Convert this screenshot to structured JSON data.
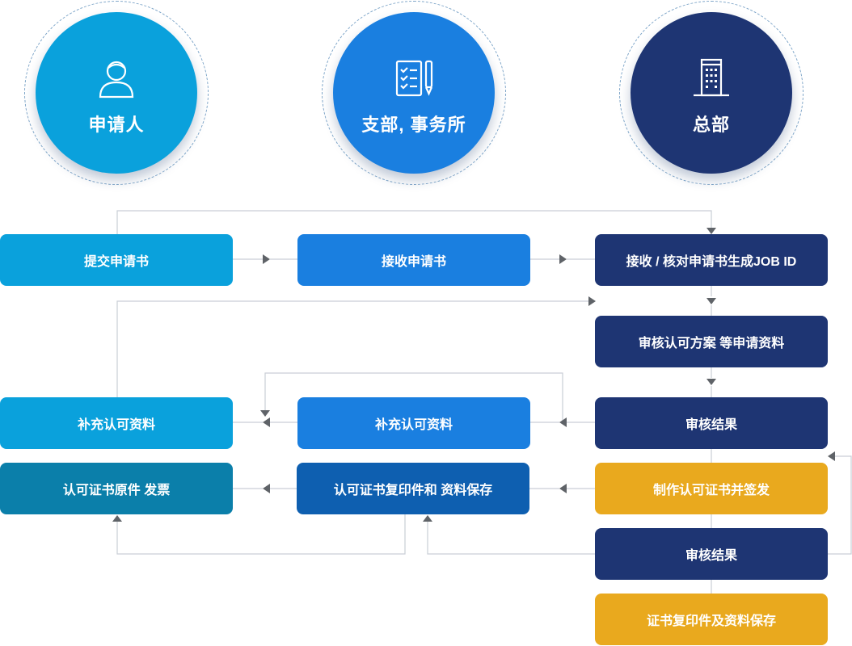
{
  "roles": {
    "applicant": "申请人",
    "branch": "支部, 事务所",
    "headquarters": "总部"
  },
  "steps": {
    "submit_application": "提交申请书",
    "receive_application": "接收申请书",
    "receive_verify": "接收 / 核对申请书生成JOB ID",
    "review_plan": "审核认可方案 等申请资料",
    "supplement_applicant": "补充认可资料",
    "supplement_branch": "补充认可资料",
    "review_result_1": "审核结果",
    "original_issue": "认可证书原件 发票",
    "copy_save_branch": "认可证书复印件和 资料保存",
    "make_issue": "制作认可证书并签发",
    "review_result_2": "审核结果",
    "copy_save_hq": "证书复印件及资料保存"
  },
  "colors": {
    "applicant": "#0aa1dc",
    "branch": "#1a7fe0",
    "headquarters": "#1e3573",
    "highlight": "#e9a91e",
    "applicant_dark": "#0b7faa",
    "branch_dark": "#0e5fb0",
    "connector": "#c9ced6",
    "arrow": "#5f6368"
  },
  "icons": {
    "applicant": "person-icon",
    "branch": "checklist-pen-icon",
    "headquarters": "building-icon"
  }
}
